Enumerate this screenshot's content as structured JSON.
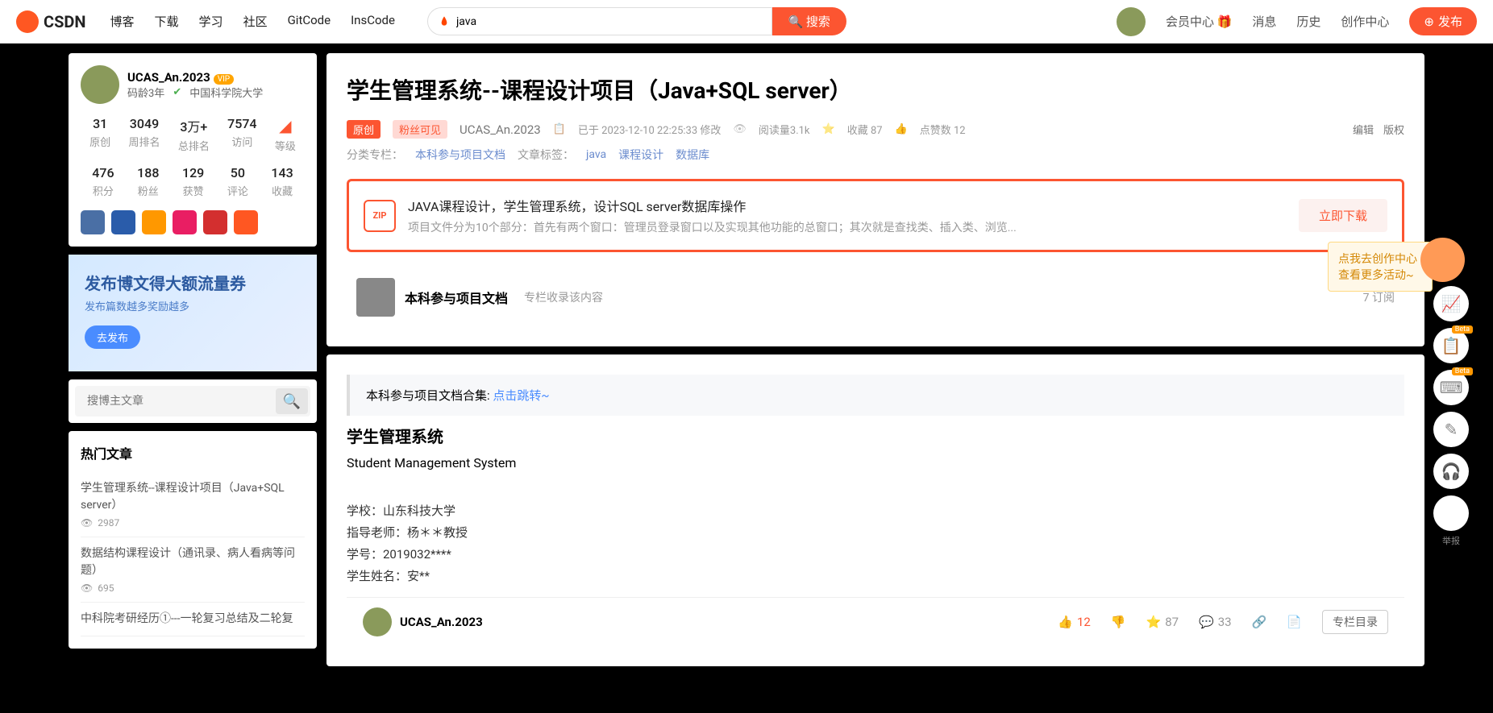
{
  "header": {
    "logo": "CSDN",
    "nav": [
      "博客",
      "下载",
      "学习",
      "社区",
      "GitCode",
      "InsCode"
    ],
    "search_value": "java",
    "search_btn": "搜索",
    "right_links": [
      "会员中心 🎁",
      "消息",
      "历史",
      "创作中心"
    ],
    "publish": "发布"
  },
  "profile": {
    "name": "UCAS_An.2023",
    "vip": "VIP",
    "age": "码龄3年",
    "school": "中国科学院大学",
    "stats1": [
      {
        "num": "31",
        "label": "原创"
      },
      {
        "num": "3049",
        "label": "周排名"
      },
      {
        "num": "3万+",
        "label": "总排名"
      },
      {
        "num": "7574",
        "label": "访问"
      }
    ],
    "level_label": "等级",
    "stats2": [
      {
        "num": "476",
        "label": "积分"
      },
      {
        "num": "188",
        "label": "粉丝"
      },
      {
        "num": "129",
        "label": "获赞"
      },
      {
        "num": "50",
        "label": "评论"
      },
      {
        "num": "143",
        "label": "收藏"
      }
    ]
  },
  "promo": {
    "title": "发布博文得大额流量券",
    "sub": "发布篇数越多奖励越多",
    "btn": "去发布"
  },
  "search_author_placeholder": "搜博主文章",
  "hot": {
    "title": "热门文章",
    "items": [
      {
        "title": "学生管理系统--课程设计项目（Java+SQL server）",
        "views": "2987"
      },
      {
        "title": "数据结构课程设计（通讯录、病人看病等问题）",
        "views": "695"
      },
      {
        "title": "中科院考研经历①---一轮复习总结及二轮复"
      }
    ]
  },
  "article": {
    "title": "学生管理系统--课程设计项目（Java+SQL server）",
    "tag_original": "原创",
    "tag_fans": "粉丝可见",
    "author": "UCAS_An.2023",
    "time": "已于 2023-12-10 22:25:33 修改",
    "views": "阅读量3.1k",
    "favs": "收藏 87",
    "likes": "点赞数 12",
    "edit": "编辑",
    "copyright": "版权",
    "cat_label": "分类专栏：",
    "cat_link": "本科参与项目文档",
    "tag_label": "文章标签：",
    "tags": [
      "java",
      "课程设计",
      "数据库"
    ]
  },
  "download": {
    "zip": "ZIP",
    "title": "JAVA课程设计，学生管理系统，设计SQL server数据库操作",
    "desc": "项目文件分为10个部分：首先有两个窗口：管理员登录窗口以及实现其他功能的总窗口；其次就是查找类、插入类、浏览...",
    "btn": "立即下载"
  },
  "column": {
    "name": "本科参与项目文档",
    "sub": "专栏收录该内容",
    "right": "7 订阅"
  },
  "notice": {
    "text": "本科参与项目文档合集: ",
    "link": "点击跳转~"
  },
  "content": {
    "h1": "学生管理系统",
    "h2": "Student Management System",
    "lines": [
      "学校：山东科技大学",
      "指导老师：杨＊＊教授",
      "学号：2019032****",
      "学生姓名：安**"
    ]
  },
  "footer": {
    "author": "UCAS_An.2023",
    "like": "12",
    "fav": "87",
    "comment": "33",
    "toc": "专栏目录"
  },
  "tooltip": "点我去创作中心查看更多活动~",
  "float_report": "举报"
}
